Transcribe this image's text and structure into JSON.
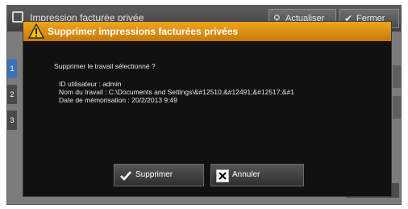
{
  "background": {
    "window_title": "Impression facturée privée",
    "update_button": "Actualiser",
    "close_button": "Fermer",
    "side_tabs": [
      "1",
      "2",
      "3"
    ]
  },
  "dialog": {
    "title": "Supprimer impressions facturées privées",
    "question": "Supprimer le travail sélectionné ?",
    "details": [
      "ID utilisateur : admin",
      "Nom du travail : C:\\Documents and Settings\\&#12510;&#12491;&#12517;&#1",
      "Date de mémorisation : 20/2/2013 9:49"
    ],
    "buttons": {
      "delete": "Supprimer",
      "cancel": "Annuler"
    }
  },
  "colors": {
    "header": "#e0920f",
    "dialog_bg": "#111111",
    "screen_bg": "#7c7c7c",
    "side_tab_active": "#3b73b8"
  }
}
